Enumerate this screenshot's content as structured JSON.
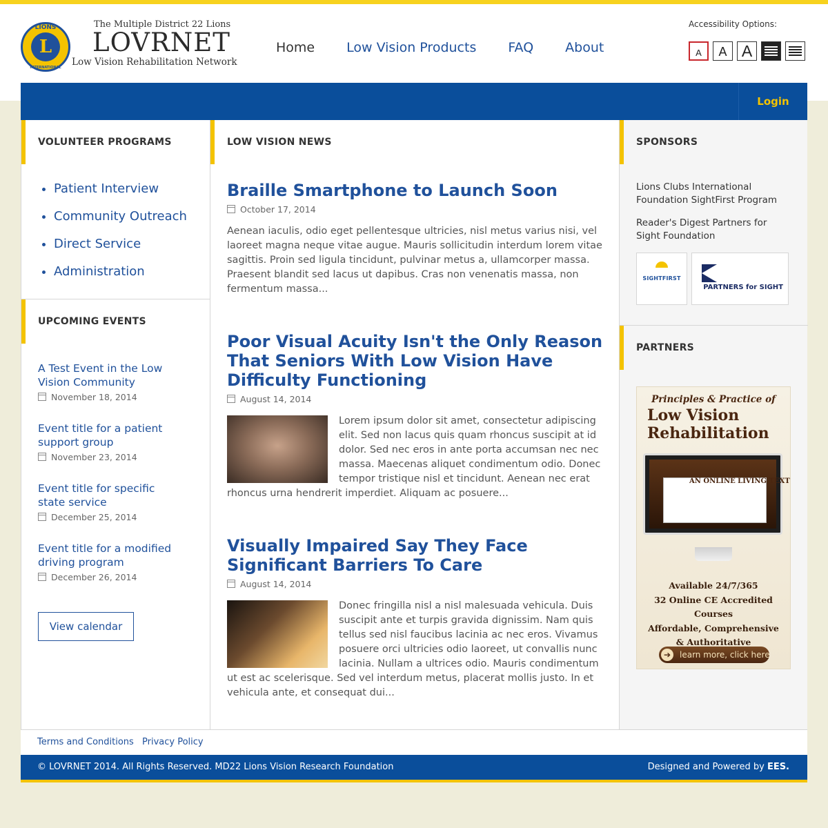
{
  "brand": {
    "tagline": "The Multiple District 22 Lions",
    "name": "LOVRNET",
    "subtitle": "Low Vision Rehabilitation Network",
    "emblem_top": "LIONS",
    "emblem_letter": "L",
    "emblem_bottom": "INTERNATIONAL"
  },
  "nav": {
    "items": [
      {
        "label": "Home",
        "active": true
      },
      {
        "label": "Low Vision Products",
        "active": false
      },
      {
        "label": "FAQ",
        "active": false
      },
      {
        "label": "About",
        "active": false
      }
    ]
  },
  "accessibility": {
    "label": "Accessibility Options:",
    "text_sizes": [
      "A",
      "A",
      "A"
    ],
    "contrast_icons": [
      "high-contrast-icon",
      "normal-contrast-icon"
    ]
  },
  "topbar": {
    "login_label": "Login"
  },
  "volunteer": {
    "heading": "VOLUNTEER PROGRAMS",
    "items": [
      "Patient Interview",
      "Community Outreach",
      "Direct Service",
      "Administration"
    ]
  },
  "events": {
    "heading": "UPCOMING EVENTS",
    "items": [
      {
        "title": "A Test Event in the Low Vision Community",
        "date": "November 18, 2014"
      },
      {
        "title": "Event title for a patient support group",
        "date": "November 23, 2014"
      },
      {
        "title": "Event title for specific state service",
        "date": "December 25, 2014"
      },
      {
        "title": "Event title for a modified driving program",
        "date": "December 26, 2014"
      }
    ],
    "view_calendar_label": "View calendar"
  },
  "news": {
    "heading": "LOW VISION NEWS",
    "articles": [
      {
        "title": "Braille Smartphone to Launch Soon",
        "date": "October 17, 2014",
        "excerpt": "Aenean iaculis, odio eget pellentesque ultricies, nisl metus varius nisi, vel laoreet magna neque vitae augue. Mauris sollicitudin interdum lorem vitae sagittis. Proin sed ligula tincidunt, pulvinar metus a, ullamcorper massa. Praesent blandit sed lacus ut dapibus. Cras non venenatis massa, non fermentum massa..."
      },
      {
        "title": "Poor Visual Acuity Isn't the Only Reason That Seniors With Low Vision Have Difficulty Functioning",
        "date": "August 14, 2014",
        "excerpt": "Lorem ipsum dolor sit amet, consectetur adipiscing elit. Sed non lacus quis quam rhoncus suscipit at id dolor. Sed nec eros in ante porta accumsan nec nec massa. Maecenas aliquet condimentum odio. Donec tempor tristique nisl et tincidunt. Aenean nec erat rhoncus urna hendrerit imperdiet. Aliquam ac posuere..."
      },
      {
        "title": "Visually Impaired Say They Face Significant Barriers To Care",
        "date": "August 14, 2014",
        "excerpt": "Donec fringilla nisl a nisl malesuada vehicula. Duis suscipit ante et turpis gravida dignissim. Nam quis tellus sed nisl faucibus lacinia ac nec eros. Vivamus posuere orci ultricies odio laoreet, ut convallis nunc lacinia. Nullam a ultrices odio. Mauris condimentum ut est ac scelerisque. Sed vel interdum metus, placerat mollis justo. In et vehicula ante, et consequat dui..."
      }
    ]
  },
  "sponsors": {
    "heading": "SPONSORS",
    "links": [
      "Lions Clubs International Foundation SightFirst Program",
      "Reader's Digest Partners for Sight Foundation"
    ],
    "logo1_text": "SIGHTFIRST",
    "logo2_text": "PARTNERS for SIGHT"
  },
  "partners": {
    "heading": "PARTNERS",
    "ad": {
      "line1": "Principles & Practice of",
      "line2": "Low Vision Rehabilitation",
      "screen_text": "AN ONLINE LIVING TEXT BOOK",
      "body1": "Available 24/7/365",
      "body2": "32 Online CE Accredited Courses",
      "body3": "Affordable, Comprehensive",
      "body4": "& Authoritative",
      "cta": "learn more, click here"
    }
  },
  "footer": {
    "links": [
      "Terms and Conditions",
      "Privacy Policy"
    ],
    "copyright": "© LOVRNET 2014. All Rights Reserved. MD22 Lions Vision Research Foundation",
    "credit_prefix": "Designed and Powered by ",
    "credit_name": "EES."
  },
  "colors": {
    "brand_blue": "#0a4e9b",
    "link_blue": "#20519b",
    "accent_yellow": "#f4c300",
    "page_bg": "#efedda"
  }
}
